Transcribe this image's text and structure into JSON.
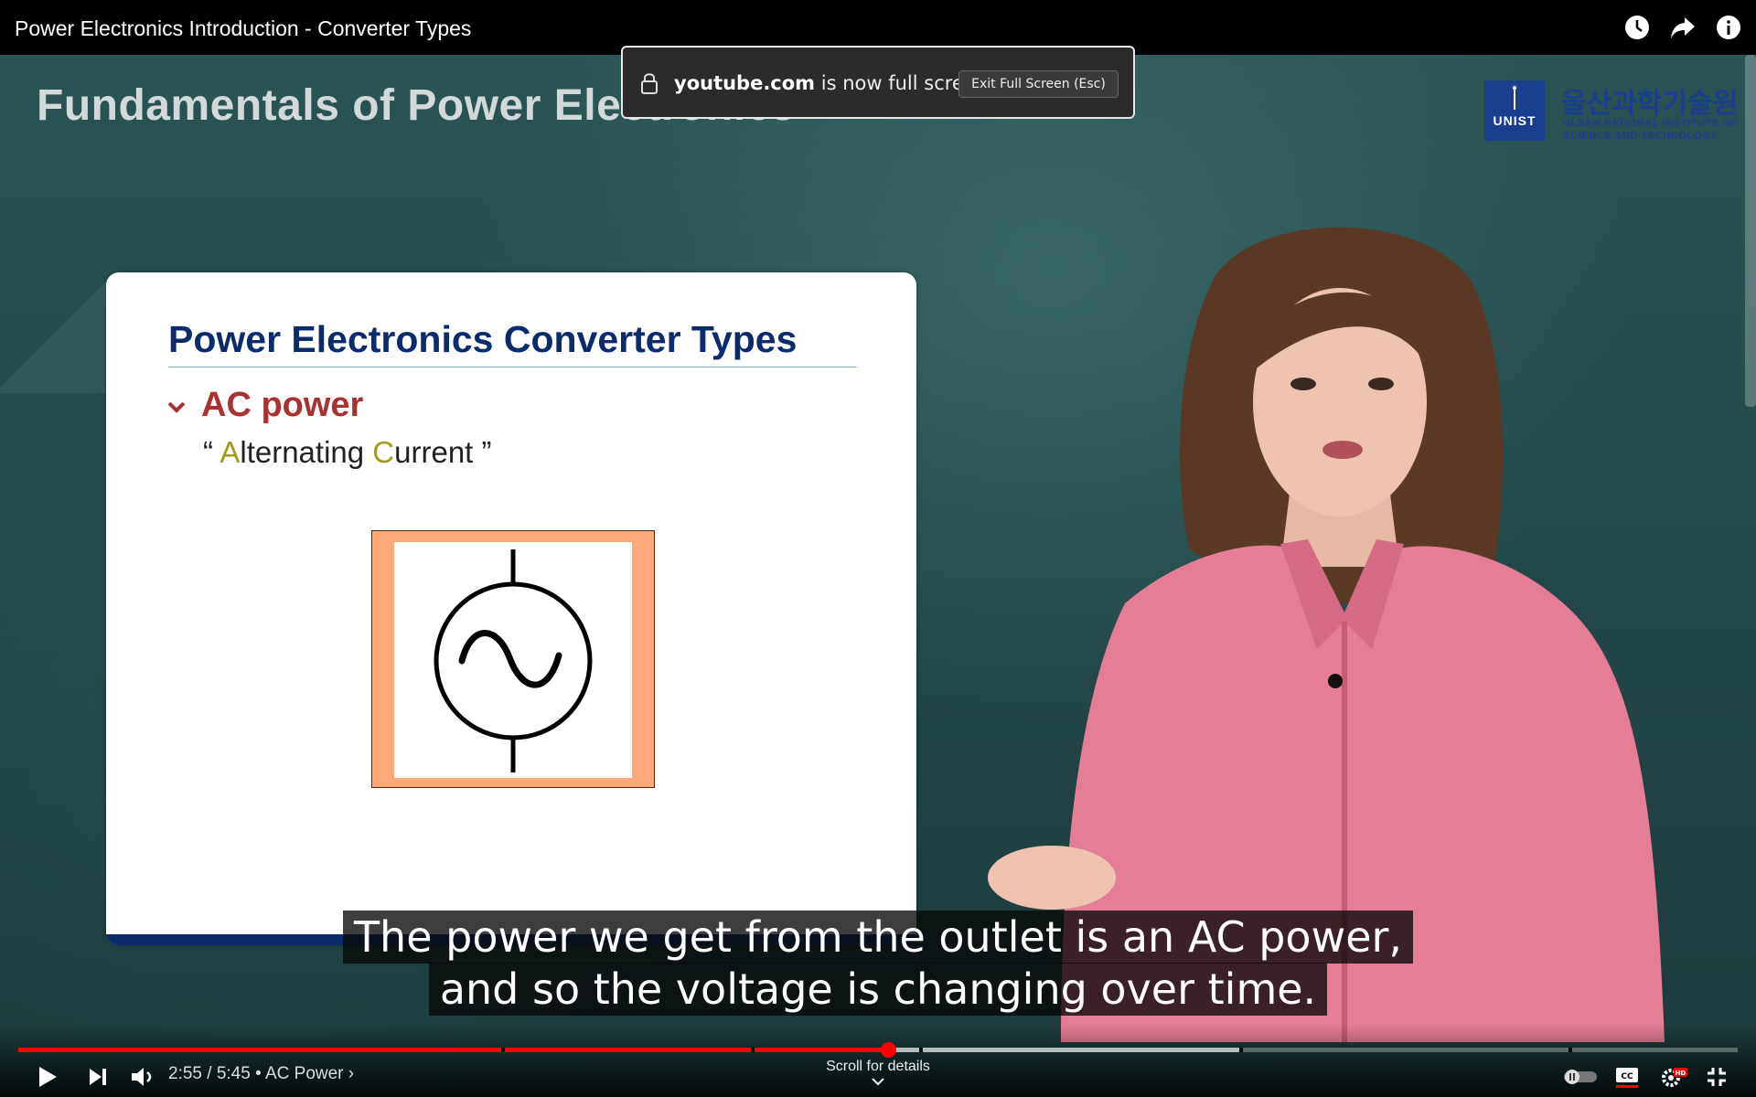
{
  "window": {
    "title": "Power Electronics Introduction - Converter Types"
  },
  "fullscreen_notice": {
    "domain": "youtube.com",
    "message": " is now full screen",
    "button": "Exit Full Screen (Esc)"
  },
  "video": {
    "heading": "Fundamentals of Power Electronics",
    "logo": {
      "mark": "UNIST",
      "korean": "울산과학기술원",
      "line1": "ULSAN NATIONAL INSTITUTE OF",
      "line2": "SCIENCE AND TECHNOLOGY"
    },
    "slide": {
      "title": "Power Electronics Converter Types",
      "bullet": "AC power",
      "sub_open": "“ ",
      "sub_a": "A",
      "sub_mid": "lternating ",
      "sub_c": "C",
      "sub_end": "urrent ”"
    },
    "captions": [
      "The power we get from the outlet is an AC power,",
      "and so the voltage is changing over time."
    ]
  },
  "player": {
    "time": "2:55 / 5:45",
    "chapter": "AC Power",
    "scroll_hint": "Scroll for details",
    "progress_fraction": 0.506,
    "buffered_fraction": 0.71,
    "icons": [
      "play-icon",
      "next-icon",
      "volume-icon",
      "autoplay-toggle",
      "captions-icon",
      "settings-icon",
      "exit-fullscreen-icon",
      "watch-later-icon",
      "share-icon",
      "info-icon"
    ],
    "accent": "#ff0000"
  }
}
